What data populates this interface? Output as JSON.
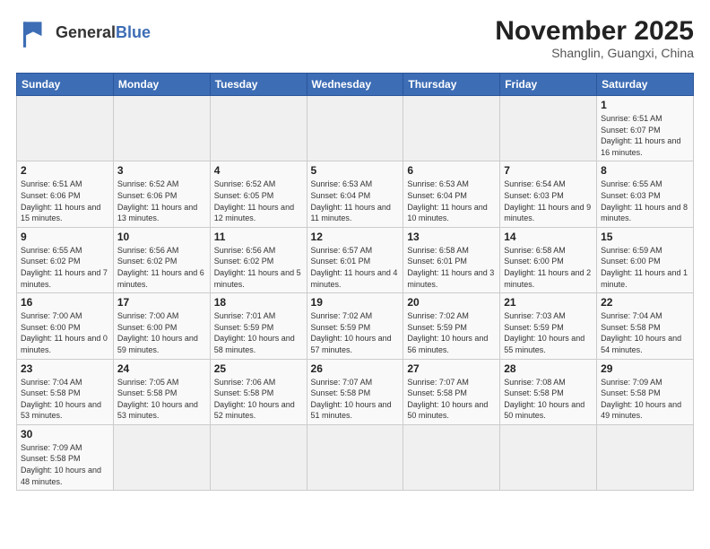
{
  "header": {
    "logo_general": "General",
    "logo_blue": "Blue",
    "month_title": "November 2025",
    "location": "Shanglin, Guangxi, China"
  },
  "weekdays": [
    "Sunday",
    "Monday",
    "Tuesday",
    "Wednesday",
    "Thursday",
    "Friday",
    "Saturday"
  ],
  "weeks": [
    [
      {
        "day": "",
        "info": ""
      },
      {
        "day": "",
        "info": ""
      },
      {
        "day": "",
        "info": ""
      },
      {
        "day": "",
        "info": ""
      },
      {
        "day": "",
        "info": ""
      },
      {
        "day": "",
        "info": ""
      },
      {
        "day": "1",
        "info": "Sunrise: 6:51 AM\nSunset: 6:07 PM\nDaylight: 11 hours\nand 16 minutes."
      }
    ],
    [
      {
        "day": "2",
        "info": "Sunrise: 6:51 AM\nSunset: 6:06 PM\nDaylight: 11 hours\nand 15 minutes."
      },
      {
        "day": "3",
        "info": "Sunrise: 6:52 AM\nSunset: 6:06 PM\nDaylight: 11 hours\nand 13 minutes."
      },
      {
        "day": "4",
        "info": "Sunrise: 6:52 AM\nSunset: 6:05 PM\nDaylight: 11 hours\nand 12 minutes."
      },
      {
        "day": "5",
        "info": "Sunrise: 6:53 AM\nSunset: 6:04 PM\nDaylight: 11 hours\nand 11 minutes."
      },
      {
        "day": "6",
        "info": "Sunrise: 6:53 AM\nSunset: 6:04 PM\nDaylight: 11 hours\nand 10 minutes."
      },
      {
        "day": "7",
        "info": "Sunrise: 6:54 AM\nSunset: 6:03 PM\nDaylight: 11 hours\nand 9 minutes."
      },
      {
        "day": "8",
        "info": "Sunrise: 6:55 AM\nSunset: 6:03 PM\nDaylight: 11 hours\nand 8 minutes."
      }
    ],
    [
      {
        "day": "9",
        "info": "Sunrise: 6:55 AM\nSunset: 6:02 PM\nDaylight: 11 hours\nand 7 minutes."
      },
      {
        "day": "10",
        "info": "Sunrise: 6:56 AM\nSunset: 6:02 PM\nDaylight: 11 hours\nand 6 minutes."
      },
      {
        "day": "11",
        "info": "Sunrise: 6:56 AM\nSunset: 6:02 PM\nDaylight: 11 hours\nand 5 minutes."
      },
      {
        "day": "12",
        "info": "Sunrise: 6:57 AM\nSunset: 6:01 PM\nDaylight: 11 hours\nand 4 minutes."
      },
      {
        "day": "13",
        "info": "Sunrise: 6:58 AM\nSunset: 6:01 PM\nDaylight: 11 hours\nand 3 minutes."
      },
      {
        "day": "14",
        "info": "Sunrise: 6:58 AM\nSunset: 6:00 PM\nDaylight: 11 hours\nand 2 minutes."
      },
      {
        "day": "15",
        "info": "Sunrise: 6:59 AM\nSunset: 6:00 PM\nDaylight: 11 hours\nand 1 minute."
      }
    ],
    [
      {
        "day": "16",
        "info": "Sunrise: 7:00 AM\nSunset: 6:00 PM\nDaylight: 11 hours\nand 0 minutes."
      },
      {
        "day": "17",
        "info": "Sunrise: 7:00 AM\nSunset: 6:00 PM\nDaylight: 10 hours\nand 59 minutes."
      },
      {
        "day": "18",
        "info": "Sunrise: 7:01 AM\nSunset: 5:59 PM\nDaylight: 10 hours\nand 58 minutes."
      },
      {
        "day": "19",
        "info": "Sunrise: 7:02 AM\nSunset: 5:59 PM\nDaylight: 10 hours\nand 57 minutes."
      },
      {
        "day": "20",
        "info": "Sunrise: 7:02 AM\nSunset: 5:59 PM\nDaylight: 10 hours\nand 56 minutes."
      },
      {
        "day": "21",
        "info": "Sunrise: 7:03 AM\nSunset: 5:59 PM\nDaylight: 10 hours\nand 55 minutes."
      },
      {
        "day": "22",
        "info": "Sunrise: 7:04 AM\nSunset: 5:58 PM\nDaylight: 10 hours\nand 54 minutes."
      }
    ],
    [
      {
        "day": "23",
        "info": "Sunrise: 7:04 AM\nSunset: 5:58 PM\nDaylight: 10 hours\nand 53 minutes."
      },
      {
        "day": "24",
        "info": "Sunrise: 7:05 AM\nSunset: 5:58 PM\nDaylight: 10 hours\nand 53 minutes."
      },
      {
        "day": "25",
        "info": "Sunrise: 7:06 AM\nSunset: 5:58 PM\nDaylight: 10 hours\nand 52 minutes."
      },
      {
        "day": "26",
        "info": "Sunrise: 7:07 AM\nSunset: 5:58 PM\nDaylight: 10 hours\nand 51 minutes."
      },
      {
        "day": "27",
        "info": "Sunrise: 7:07 AM\nSunset: 5:58 PM\nDaylight: 10 hours\nand 50 minutes."
      },
      {
        "day": "28",
        "info": "Sunrise: 7:08 AM\nSunset: 5:58 PM\nDaylight: 10 hours\nand 50 minutes."
      },
      {
        "day": "29",
        "info": "Sunrise: 7:09 AM\nSunset: 5:58 PM\nDaylight: 10 hours\nand 49 minutes."
      }
    ],
    [
      {
        "day": "30",
        "info": "Sunrise: 7:09 AM\nSunset: 5:58 PM\nDaylight: 10 hours\nand 48 minutes."
      },
      {
        "day": "",
        "info": ""
      },
      {
        "day": "",
        "info": ""
      },
      {
        "day": "",
        "info": ""
      },
      {
        "day": "",
        "info": ""
      },
      {
        "day": "",
        "info": ""
      },
      {
        "day": "",
        "info": ""
      }
    ]
  ]
}
